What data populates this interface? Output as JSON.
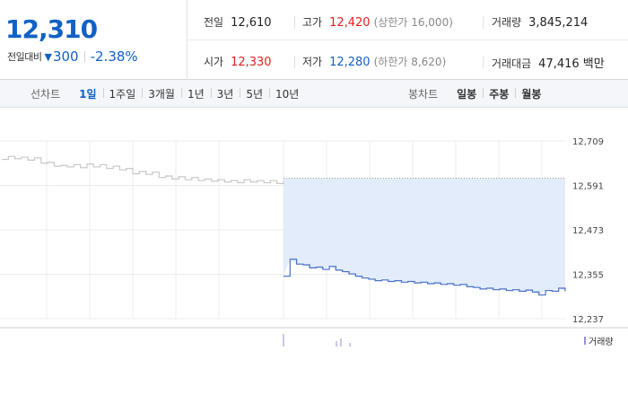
{
  "summary": {
    "current_price": "12,310",
    "change_label": "전일대비",
    "change_icon": "down-triangle-icon",
    "change_amount": "300",
    "change_percent": "-2.38%",
    "prev_close": {
      "label": "전일",
      "value": "12,610"
    },
    "open": {
      "label": "시가",
      "value": "12,330"
    },
    "high": {
      "label": "고가",
      "value": "12,420",
      "sub": "(상한가 16,000)"
    },
    "low": {
      "label": "저가",
      "value": "12,280",
      "sub": "(하한가 8,620)"
    },
    "volume": {
      "label": "거래량",
      "value": "3,845,214"
    },
    "trade_value": {
      "label": "거래대금",
      "value": "47,416 백만"
    },
    "colors": {
      "down": "#1261c4",
      "up": "#e41e1e"
    }
  },
  "toolbar": {
    "line_label": "선차트",
    "line_periods": [
      "1일",
      "1주일",
      "3개월",
      "1년",
      "3년",
      "5년",
      "10년"
    ],
    "active_period": "1일",
    "candle_label": "봉차트",
    "candle_periods": [
      "일봉",
      "주봉",
      "월봉"
    ]
  },
  "chart_data": {
    "type": "line",
    "y_ticks": [
      "12,709",
      "12,591",
      "12,473",
      "12,355",
      "12,237"
    ],
    "ylim": [
      12237,
      12709
    ],
    "reference_line": 12610,
    "grid": true,
    "series": [
      {
        "values": [
          12660,
          12668,
          12662,
          12666,
          12658,
          12664,
          12650,
          12652,
          12642,
          12644,
          12640,
          12646,
          12638,
          12648,
          12640,
          12646,
          12636,
          12642,
          12632,
          12636,
          12622,
          12628,
          12620,
          12626,
          12612,
          12616,
          12608,
          12614,
          12606,
          12612,
          12604,
          12608,
          12602,
          12606,
          12600,
          12604,
          12598,
          12606,
          12600,
          12604,
          12598,
          12604,
          12596,
          12602
        ]
      },
      {
        "values": [
          12350,
          12395,
          12382,
          12380,
          12372,
          12374,
          12368,
          12376,
          12366,
          12362,
          12356,
          12350,
          12345,
          12342,
          12338,
          12340,
          12336,
          12338,
          12334,
          12336,
          12332,
          12334,
          12330,
          12332,
          12328,
          12330,
          12326,
          12328,
          12322,
          12320,
          12316,
          12318,
          12314,
          12316,
          12312,
          12314,
          12310,
          12313,
          12308,
          12300,
          12312,
          12310,
          12318,
          12310
        ]
      }
    ],
    "fill_color": "#e3ecfa",
    "today_color": "#4a72c9",
    "prev_color": "#c8c8c8",
    "legend": "거래량",
    "legend_color": "#9b8fcf"
  }
}
